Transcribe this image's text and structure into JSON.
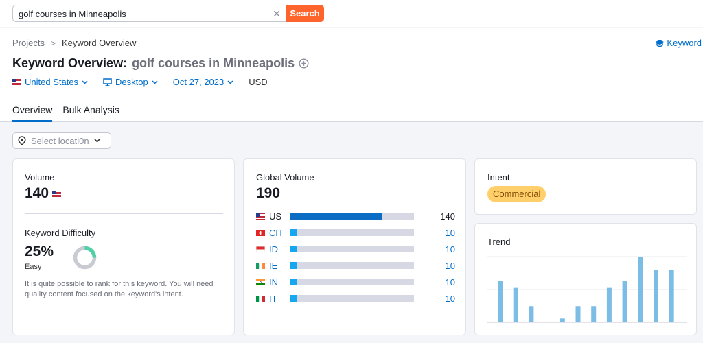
{
  "search": {
    "value": "golf courses in Minneapolis",
    "button_label": "Search"
  },
  "breadcrumb": {
    "root": "Projects",
    "current": "Keyword Overview"
  },
  "top_right_link": {
    "label": "Keyword"
  },
  "page": {
    "title": "Keyword Overview:",
    "keyword": "golf courses in Minneapolis"
  },
  "filters": {
    "country": "United States",
    "device": "Desktop",
    "date": "Oct 27, 2023",
    "currency": "USD"
  },
  "tabs": [
    "Overview",
    "Bulk Analysis"
  ],
  "location_select": {
    "placeholder": "Select locati0n"
  },
  "volume": {
    "label": "Volume",
    "value": "140"
  },
  "keyword_difficulty": {
    "label": "Keyword Difficulty",
    "value": "25%",
    "level": "Easy",
    "percent": 25,
    "description": "It is quite possible to rank for this keyword. You will need quality content focused on the keyword's intent."
  },
  "global_volume": {
    "label": "Global Volume",
    "value": "190",
    "countries": [
      {
        "code": "US",
        "value": "140",
        "fraction": 0.74
      },
      {
        "code": "CH",
        "value": "10",
        "fraction": 0.05
      },
      {
        "code": "ID",
        "value": "10",
        "fraction": 0.05
      },
      {
        "code": "IE",
        "value": "10",
        "fraction": 0.05
      },
      {
        "code": "IN",
        "value": "10",
        "fraction": 0.05
      },
      {
        "code": "IT",
        "value": "10",
        "fraction": 0.05
      }
    ]
  },
  "intent": {
    "label": "Intent",
    "value": "Commercial"
  },
  "trend": {
    "label": "Trend",
    "values": [
      0.64,
      0.53,
      0.25,
      0.0,
      0.06,
      0.25,
      0.25,
      0.53,
      0.64,
      1.0,
      0.81,
      0.81
    ]
  },
  "colors": {
    "accent": "#006dca",
    "search_button": "#ff642d",
    "bar_primary": "#0b6cc4",
    "bar_secondary": "#16a7f0",
    "bar_track": "#d6d9e3",
    "trend_bar": "#7cbde6",
    "intent_badge": "#ffcf6b",
    "kd_green": "#4fd1a5",
    "kd_track": "#c9cbd3"
  },
  "icons": {
    "clear": "close-icon",
    "keyword_link": "graduation-cap-icon",
    "add": "plus-circle-icon",
    "country": "us-flag-icon",
    "device": "monitor-icon",
    "location": "map-pin-icon"
  }
}
